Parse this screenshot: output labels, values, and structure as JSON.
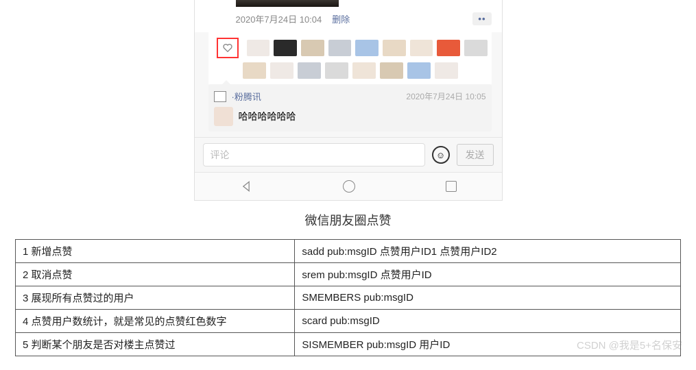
{
  "post": {
    "timestamp": "2020年7月24日 10:04",
    "delete_label": "删除",
    "more": "••"
  },
  "comment": {
    "author": "·粉腾讯",
    "time": "2020年7月24日 10:05",
    "text": "哈哈哈哈哈哈"
  },
  "input": {
    "placeholder": "评论",
    "send_label": "发送"
  },
  "caption": "微信朋友圈点赞",
  "rows": [
    {
      "n": "1",
      "desc": "新增点赞",
      "cmd": "sadd pub:msgID  点赞用户ID1  点赞用户ID2"
    },
    {
      "n": "2",
      "desc": "取消点赞",
      "cmd": "srem pub:msgID  点赞用户ID"
    },
    {
      "n": "3",
      "desc": "展现所有点赞过的用户",
      "cmd": "SMEMBERS  pub:msgID"
    },
    {
      "n": "4",
      "desc": "点赞用户数统计，就是常见的点赞红色数字",
      "cmd": "scard  pub:msgID"
    },
    {
      "n": "5",
      "desc": "判断某个朋友是否对楼主点赞过",
      "cmd": "SISMEMBER pub:msgID 用户ID"
    }
  ],
  "watermark": "CSDN @我是5+名保安"
}
